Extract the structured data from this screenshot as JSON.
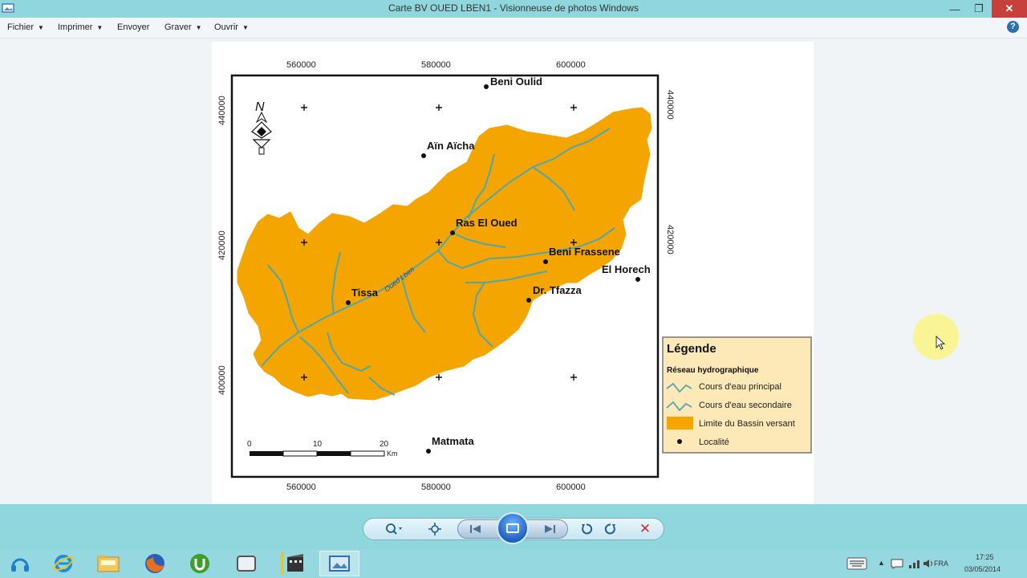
{
  "window": {
    "title": "Carte BV OUED LBEN1 - Visionneuse de photos Windows",
    "minimize_icon": "minimize-icon",
    "maximize_icon": "restore-icon",
    "close_icon": "close-icon"
  },
  "menu": {
    "items": [
      {
        "label": "Fichier",
        "has_caret": true
      },
      {
        "label": "Imprimer",
        "has_caret": true
      },
      {
        "label": "Envoyer",
        "has_caret": false
      },
      {
        "label": "Graver",
        "has_caret": true
      },
      {
        "label": "Ouvrir",
        "has_caret": true
      }
    ],
    "help_icon": "help-icon",
    "help_label": "?"
  },
  "map": {
    "north_label": "N",
    "top_ticks": [
      "560000",
      "580000",
      "600000"
    ],
    "bottom_ticks": [
      "560000",
      "580000",
      "600000"
    ],
    "left_ticks": [
      "440000",
      "420000",
      "400000"
    ],
    "right_ticks": [
      "440000",
      "420000",
      "400000"
    ],
    "river_label": "Oued Lben",
    "localities": [
      {
        "name": "Beni Oulid"
      },
      {
        "name": "Aïn Aïcha"
      },
      {
        "name": "Ras El Oued"
      },
      {
        "name": "Beni Frassene"
      },
      {
        "name": "El Horech"
      },
      {
        "name": "Tissa"
      },
      {
        "name": "Dr. Tfazza"
      },
      {
        "name": "Matmata"
      }
    ],
    "scale": {
      "labels": [
        "0",
        "10",
        "20"
      ],
      "unit": "Km"
    },
    "colors": {
      "basin": "#f5a500",
      "river": "#4ea7b0",
      "frame": "#111111"
    }
  },
  "legend": {
    "title": "Légende",
    "section": "Réseau hydrographique",
    "items": [
      {
        "label": "Cours d'eau principal",
        "symbol": "line"
      },
      {
        "label": "Cours d'eau secondaire",
        "symbol": "line"
      },
      {
        "label": "Limite du Bassin versant",
        "symbol": "fill"
      },
      {
        "label": "Localité",
        "symbol": "dot"
      }
    ],
    "background": "#fde8b8"
  },
  "controls": {
    "zoom_icon": "zoom-icon",
    "fit_icon": "actual-size-icon",
    "previous_icon": "previous-icon",
    "slideshow_icon": "slideshow-icon",
    "next_icon": "next-icon",
    "rotate_left_icon": "rotate-counterclockwise-icon",
    "rotate_right_icon": "rotate-clockwise-icon",
    "delete_icon": "delete-icon"
  },
  "taskbar": {
    "apps": [
      {
        "icon": "headset-icon"
      },
      {
        "icon": "internet-explorer-icon"
      },
      {
        "icon": "file-explorer-icon"
      },
      {
        "icon": "firefox-icon"
      },
      {
        "icon": "utorrent-icon"
      },
      {
        "icon": "window-icon"
      },
      {
        "icon": "movie-maker-icon"
      },
      {
        "icon": "photo-viewer-icon",
        "active": true
      }
    ],
    "tray": {
      "language": "FRA",
      "time": "17:25",
      "date": "03/05/2014"
    }
  }
}
